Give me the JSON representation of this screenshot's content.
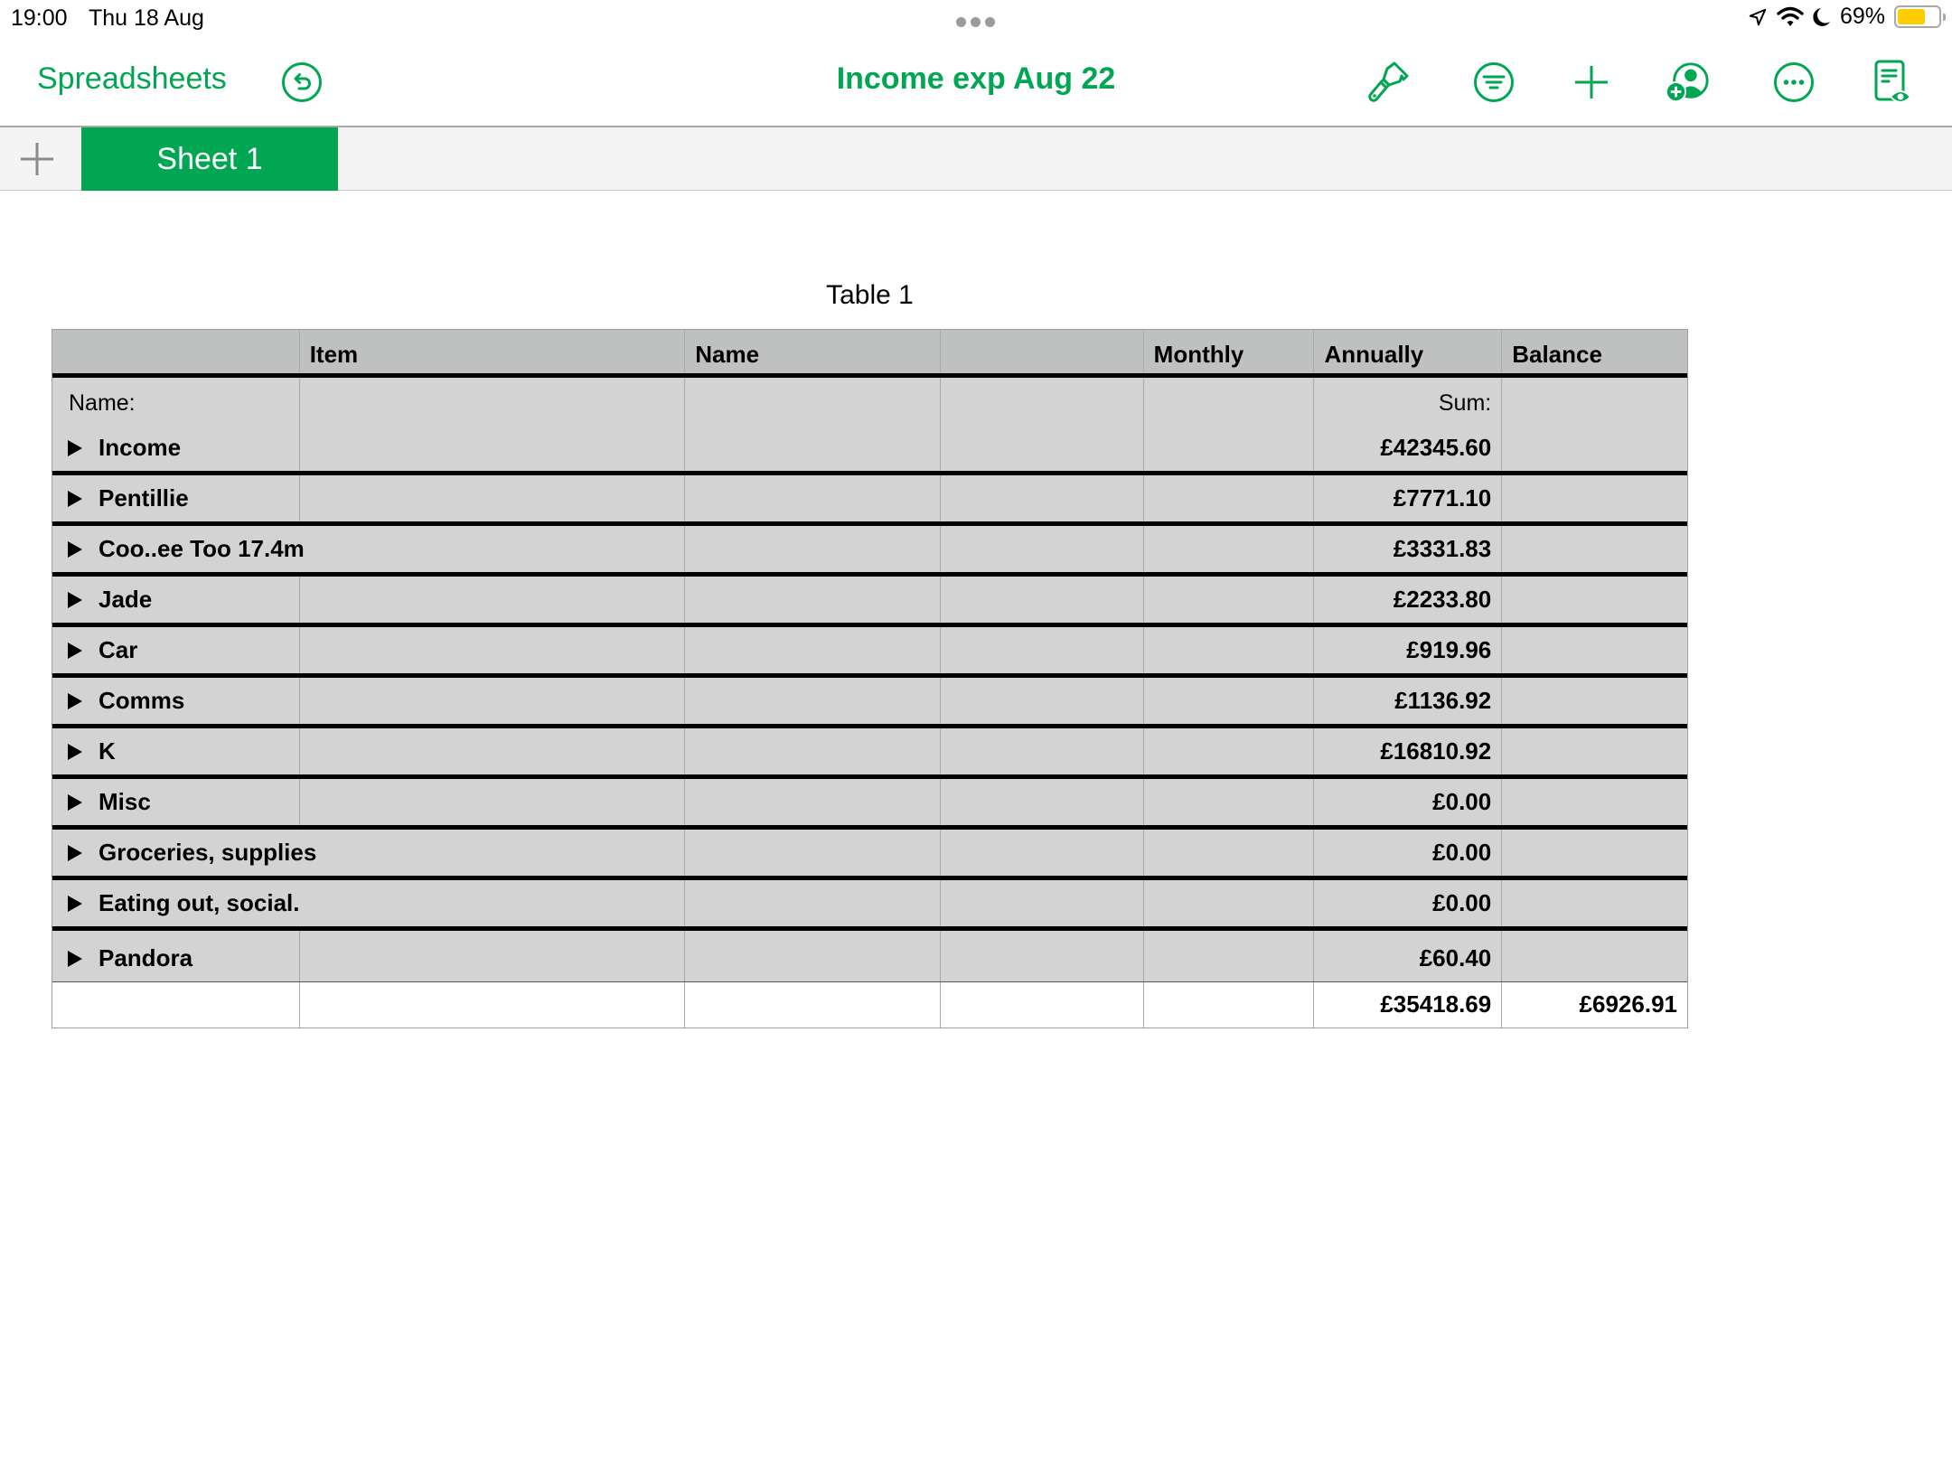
{
  "status_bar": {
    "time": "19:00",
    "date": "Thu 18 Aug",
    "battery_percent_label": "69%",
    "battery_level": 0.69,
    "icons": [
      "location-arrow-icon",
      "wifi-icon",
      "moon-icon",
      "battery-icon"
    ]
  },
  "toolbar": {
    "back_label": "Spreadsheets",
    "document_title": "Income exp Aug 22",
    "buttons": [
      "undo",
      "format-brush",
      "organize",
      "insert",
      "collaborate",
      "more",
      "reader-view"
    ],
    "accent_color": "#00A651"
  },
  "sheets": {
    "add_label": "+",
    "tabs": [
      {
        "label": "Sheet 1",
        "active": true
      }
    ]
  },
  "table": {
    "title": "Table 1",
    "columns": [
      "",
      "Item",
      "Name",
      "",
      "Monthly",
      "Annually",
      "Balance"
    ],
    "group_header": {
      "name_label": "Name:",
      "sum_label": "Sum:"
    },
    "categories": [
      {
        "label": "Income",
        "annually": "£42345.60",
        "balance": ""
      },
      {
        "label": "Pentillie",
        "annually": "£7771.10",
        "balance": ""
      },
      {
        "label": "Coo..ee Too 17.4m",
        "annually": "£3331.83",
        "balance": ""
      },
      {
        "label": "Jade",
        "annually": "£2233.80",
        "balance": ""
      },
      {
        "label": "Car",
        "annually": "£919.96",
        "balance": ""
      },
      {
        "label": "Comms",
        "annually": "£1136.92",
        "balance": ""
      },
      {
        "label": "K",
        "annually": "£16810.92",
        "balance": ""
      },
      {
        "label": "Misc",
        "annually": "£0.00",
        "balance": ""
      },
      {
        "label": "Groceries, supplies",
        "annually": "£0.00",
        "balance": ""
      },
      {
        "label": "Eating out, social.",
        "annually": "£0.00",
        "balance": ""
      },
      {
        "label": "Pandora",
        "annually": "£60.40",
        "balance": ""
      }
    ],
    "footer": {
      "annually": "£35418.69",
      "balance": "£6926.91"
    }
  }
}
